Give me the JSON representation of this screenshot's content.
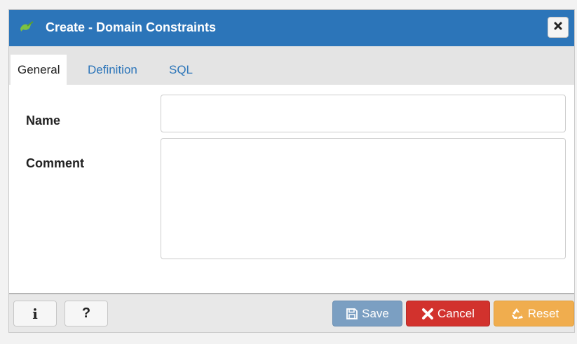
{
  "dialog": {
    "title": "Create - Domain Constraints",
    "logo_icon": "elephant-logo-icon",
    "close_icon": "close-icon"
  },
  "tabs": [
    {
      "label": "General",
      "active": true
    },
    {
      "label": "Definition",
      "active": false
    },
    {
      "label": "SQL",
      "active": false
    }
  ],
  "form": {
    "name_label": "Name",
    "name_value": "",
    "comment_label": "Comment",
    "comment_value": ""
  },
  "footer": {
    "info_label": "i",
    "help_label": "?",
    "save_label": "Save",
    "cancel_label": "Cancel",
    "reset_label": "Reset"
  },
  "colors": {
    "titlebar": "#2c75b9",
    "save": "#7b9fc2",
    "cancel": "#d2322d",
    "reset": "#f0ad4e"
  }
}
